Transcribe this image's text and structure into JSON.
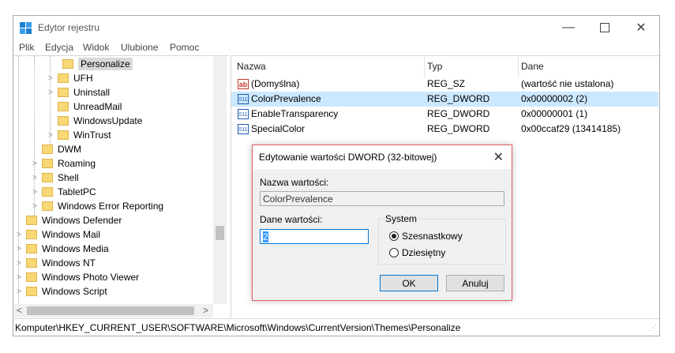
{
  "window": {
    "title": "Edytor rejestru"
  },
  "menu": [
    "Plik",
    "Edycja",
    "Widok",
    "Ulubione",
    "Pomoc"
  ],
  "tree": {
    "items": [
      {
        "label": "Personalize",
        "selected": true
      },
      {
        "label": "UFH"
      },
      {
        "label": "Uninstall"
      },
      {
        "label": "UnreadMail"
      },
      {
        "label": "WindowsUpdate"
      },
      {
        "label": "WinTrust"
      },
      {
        "label": "DWM"
      },
      {
        "label": "Roaming"
      },
      {
        "label": "Shell"
      },
      {
        "label": "TabletPC"
      },
      {
        "label": "Windows Error Reporting"
      },
      {
        "label": "Windows Defender"
      },
      {
        "label": "Windows Mail"
      },
      {
        "label": "Windows Media"
      },
      {
        "label": "Windows NT"
      },
      {
        "label": "Windows Photo Viewer"
      },
      {
        "label": "Windows Script"
      }
    ]
  },
  "values": {
    "columns": [
      "Nazwa",
      "Typ",
      "Dane"
    ],
    "rows": [
      {
        "name": "(Domyślna)",
        "type": "REG_SZ",
        "data": "(wartość nie ustalona)",
        "icon": "ab"
      },
      {
        "name": "ColorPrevalence",
        "type": "REG_DWORD",
        "data": "0x00000002 (2)",
        "icon": "dword",
        "selected": true
      },
      {
        "name": "EnableTransparency",
        "type": "REG_DWORD",
        "data": "0x00000001 (1)",
        "icon": "dword"
      },
      {
        "name": "SpecialColor",
        "type": "REG_DWORD",
        "data": "0x00ccaf29 (13414185)",
        "icon": "dword"
      }
    ]
  },
  "status": {
    "path": "Komputer\\HKEY_CURRENT_USER\\SOFTWARE\\Microsoft\\Windows\\CurrentVersion\\Themes\\Personalize"
  },
  "dialog": {
    "title": "Edytowanie wartości DWORD (32-bitowej)",
    "name_label": "Nazwa wartości:",
    "name_value": "ColorPrevalence",
    "data_label": "Dane wartości:",
    "data_value": "2",
    "base_label": "System",
    "radio_hex": "Szesnastkowy",
    "radio_dec": "Dziesiętny",
    "ok": "OK",
    "cancel": "Anuluj"
  },
  "colors": {
    "selection": "#cce8ff",
    "folder": "#f8d775",
    "dialog_border": "#e06060"
  }
}
